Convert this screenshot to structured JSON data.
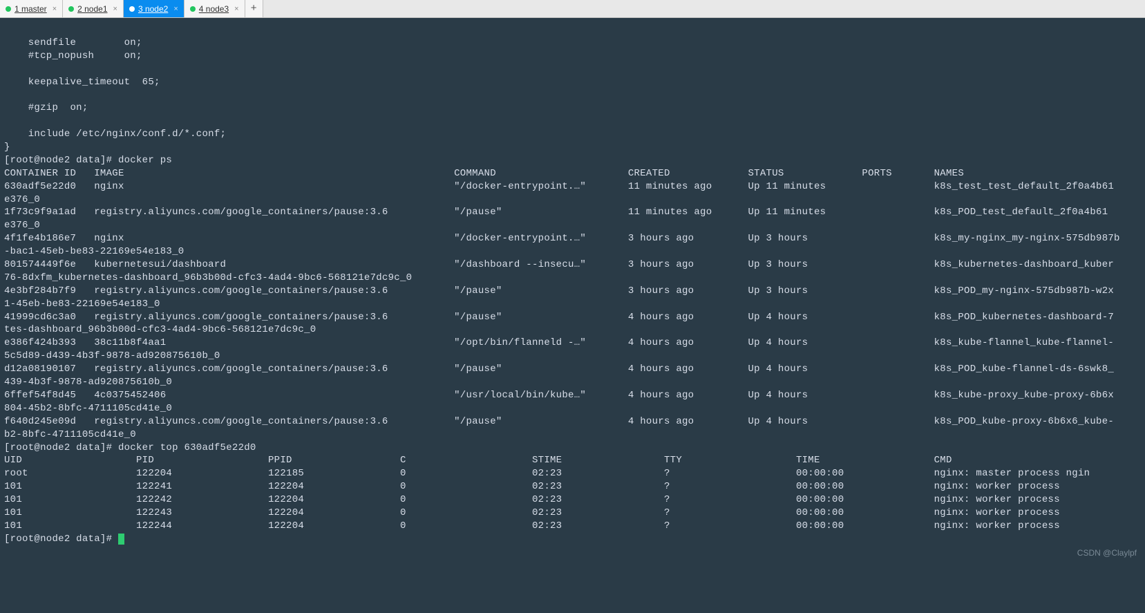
{
  "tabs": [
    {
      "label": "1 master",
      "active": false
    },
    {
      "label": "2 node1",
      "active": false
    },
    {
      "label": "3 node2",
      "active": true
    },
    {
      "label": "4 node3",
      "active": false
    }
  ],
  "watermark": "CSDN @Claylpf",
  "nginx_conf": [
    "    sendfile        on;",
    "    #tcp_nopush     on;",
    "",
    "    keepalive_timeout  65;",
    "",
    "    #gzip  on;",
    "",
    "    include /etc/nginx/conf.d/*.conf;",
    "}"
  ],
  "prompt1": "[root@node2 data]# docker ps",
  "docker_ps": {
    "headers": [
      "CONTAINER ID",
      "IMAGE",
      "COMMAND",
      "CREATED",
      "STATUS",
      "PORTS",
      "NAMES"
    ],
    "rows": [
      {
        "id": "630adf5e22d0",
        "image": "nginx",
        "command": "\"/docker-entrypoint.…\"",
        "created": "11 minutes ago",
        "status": "Up 11 minutes",
        "ports": "",
        "names": "k8s_test_test_default_2f0a4b61",
        "wrap": "e376_0"
      },
      {
        "id": "1f73c9f9a1ad",
        "image": "registry.aliyuncs.com/google_containers/pause:3.6",
        "command": "\"/pause\"",
        "created": "11 minutes ago",
        "status": "Up 11 minutes",
        "ports": "",
        "names": "k8s_POD_test_default_2f0a4b61",
        "wrap": "e376_0"
      },
      {
        "id": "4f1fe4b186e7",
        "image": "nginx",
        "command": "\"/docker-entrypoint.…\"",
        "created": "3 hours ago",
        "status": "Up 3 hours",
        "ports": "",
        "names": "k8s_my-nginx_my-nginx-575db987b",
        "wrap": "-bac1-45eb-be83-22169e54e183_0"
      },
      {
        "id": "801574449f6e",
        "image": "kubernetesui/dashboard",
        "command": "\"/dashboard --insecu…\"",
        "created": "3 hours ago",
        "status": "Up 3 hours",
        "ports": "",
        "names": "k8s_kubernetes-dashboard_kuber",
        "wrap": "76-8dxfm_kubernetes-dashboard_96b3b00d-cfc3-4ad4-9bc6-568121e7dc9c_0"
      },
      {
        "id": "4e3bf284b7f9",
        "image": "registry.aliyuncs.com/google_containers/pause:3.6",
        "command": "\"/pause\"",
        "created": "3 hours ago",
        "status": "Up 3 hours",
        "ports": "",
        "names": "k8s_POD_my-nginx-575db987b-w2x",
        "wrap": "1-45eb-be83-22169e54e183_0"
      },
      {
        "id": "41999cd6c3a0",
        "image": "registry.aliyuncs.com/google_containers/pause:3.6",
        "command": "\"/pause\"",
        "created": "4 hours ago",
        "status": "Up 4 hours",
        "ports": "",
        "names": "k8s_POD_kubernetes-dashboard-7",
        "wrap": "tes-dashboard_96b3b00d-cfc3-4ad4-9bc6-568121e7dc9c_0"
      },
      {
        "id": "e386f424b393",
        "image": "38c11b8f4aa1",
        "command": "\"/opt/bin/flanneld -…\"",
        "created": "4 hours ago",
        "status": "Up 4 hours",
        "ports": "",
        "names": "k8s_kube-flannel_kube-flannel-",
        "wrap": "5c5d89-d439-4b3f-9878-ad920875610b_0"
      },
      {
        "id": "d12a08190107",
        "image": "registry.aliyuncs.com/google_containers/pause:3.6",
        "command": "\"/pause\"",
        "created": "4 hours ago",
        "status": "Up 4 hours",
        "ports": "",
        "names": "k8s_POD_kube-flannel-ds-6swk8_",
        "wrap": "439-4b3f-9878-ad920875610b_0"
      },
      {
        "id": "6ffef54f8d45",
        "image": "4c0375452406",
        "command": "\"/usr/local/bin/kube…\"",
        "created": "4 hours ago",
        "status": "Up 4 hours",
        "ports": "",
        "names": "k8s_kube-proxy_kube-proxy-6b6x",
        "wrap": "804-45b2-8bfc-4711105cd41e_0"
      },
      {
        "id": "f640d245e09d",
        "image": "registry.aliyuncs.com/google_containers/pause:3.6",
        "command": "\"/pause\"",
        "created": "4 hours ago",
        "status": "Up 4 hours",
        "ports": "",
        "names": "k8s_POD_kube-proxy-6b6x6_kube-",
        "wrap": "b2-8bfc-4711105cd41e_0"
      }
    ]
  },
  "prompt2": "[root@node2 data]# docker top 630adf5e22d0",
  "docker_top": {
    "headers": [
      "UID",
      "PID",
      "PPID",
      "C",
      "STIME",
      "TTY",
      "TIME",
      "CMD"
    ],
    "rows": [
      {
        "uid": "root",
        "pid": "122204",
        "ppid": "122185",
        "c": "0",
        "st": "02:23",
        "tty": "?",
        "time": "00:00:00",
        "cmd": "nginx: master process ngin"
      },
      {
        "uid": "101",
        "pid": "122241",
        "ppid": "122204",
        "c": "0",
        "st": "02:23",
        "tty": "?",
        "time": "00:00:00",
        "cmd": "nginx: worker process"
      },
      {
        "uid": "101",
        "pid": "122242",
        "ppid": "122204",
        "c": "0",
        "st": "02:23",
        "tty": "?",
        "time": "00:00:00",
        "cmd": "nginx: worker process"
      },
      {
        "uid": "101",
        "pid": "122243",
        "ppid": "122204",
        "c": "0",
        "st": "02:23",
        "tty": "?",
        "time": "00:00:00",
        "cmd": "nginx: worker process"
      },
      {
        "uid": "101",
        "pid": "122244",
        "ppid": "122204",
        "c": "0",
        "st": "02:23",
        "tty": "?",
        "time": "00:00:00",
        "cmd": "nginx: worker process"
      }
    ]
  },
  "prompt3": "[root@node2 data]# "
}
